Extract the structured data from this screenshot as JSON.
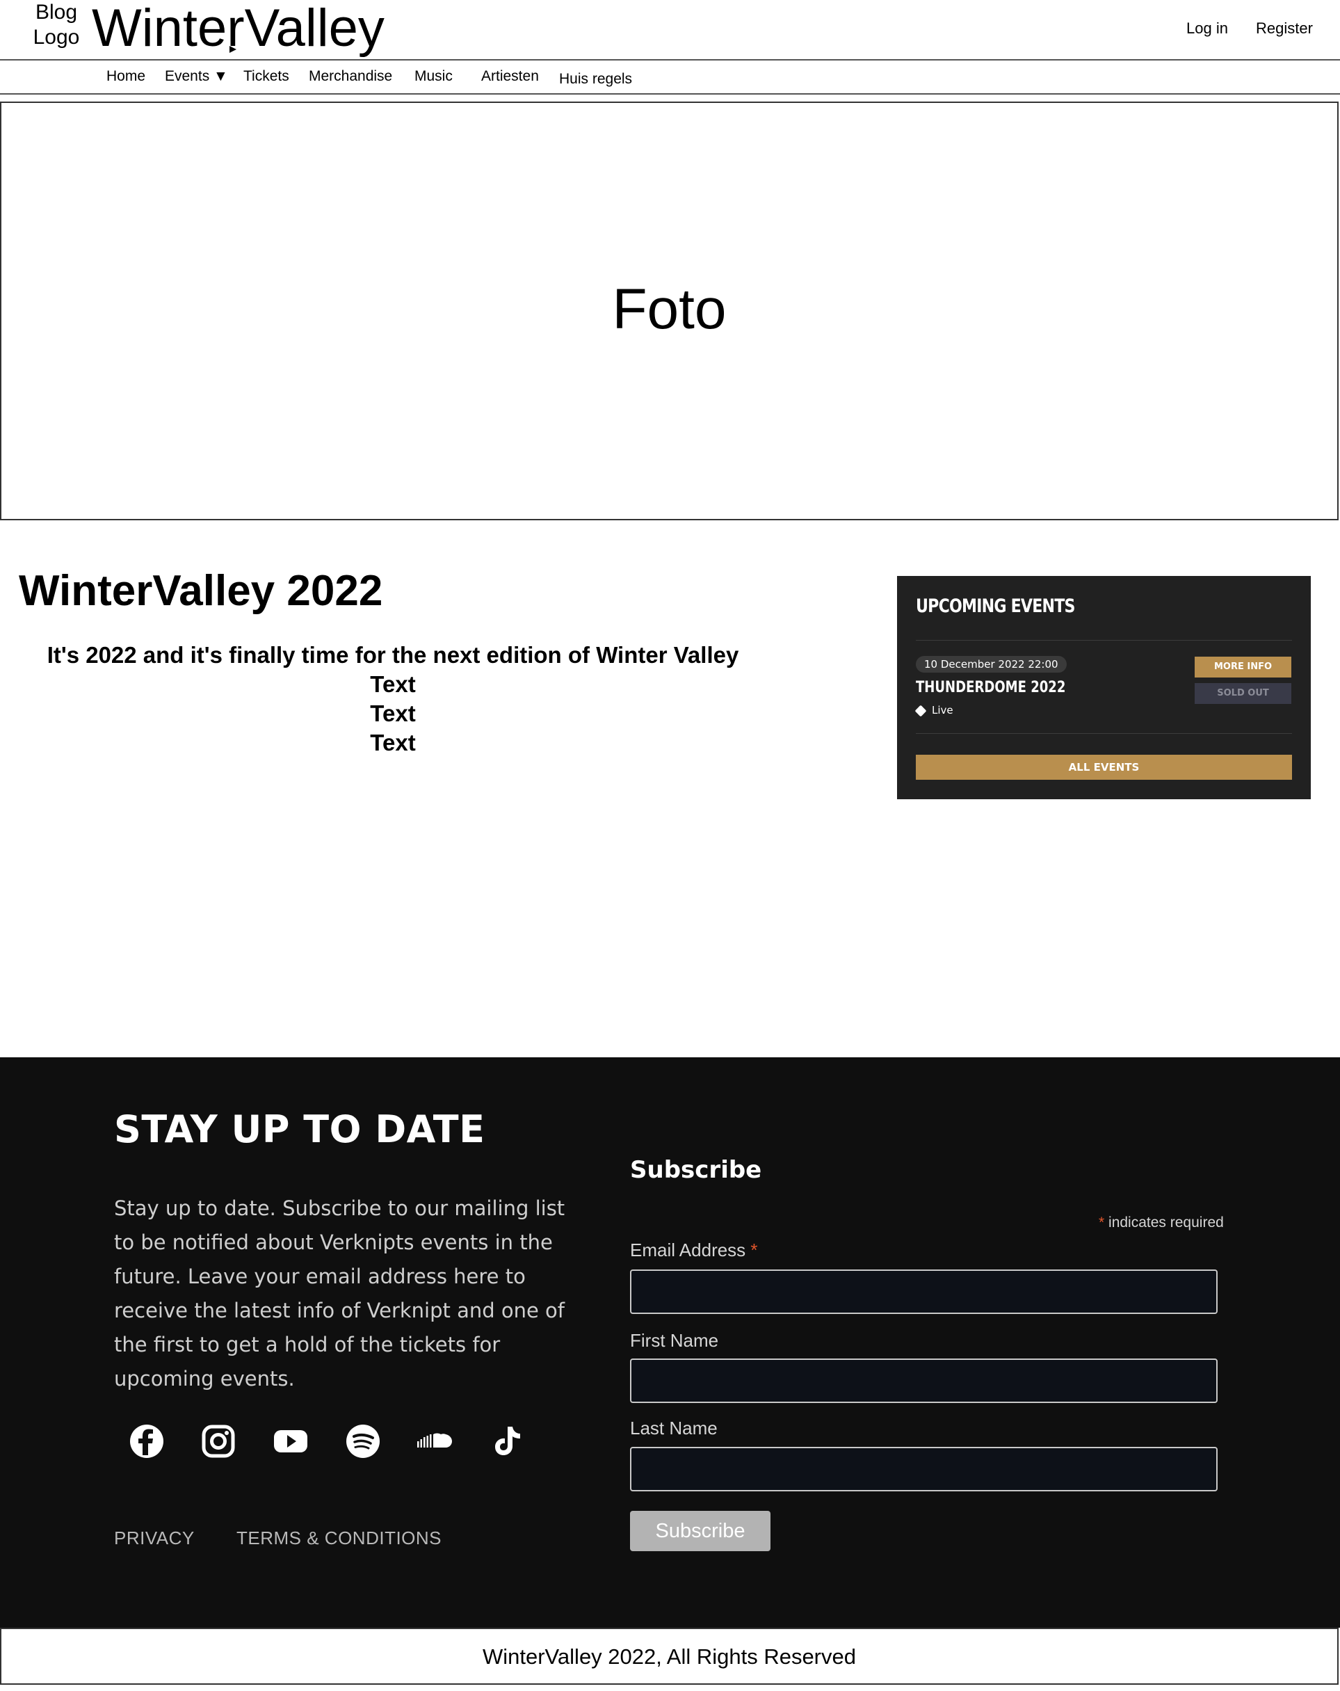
{
  "header": {
    "logo_text": "Blog Logo",
    "site_title": "WinterValley",
    "login": "Log in",
    "register": "Register"
  },
  "nav": {
    "items": [
      "Home",
      "Events ▼",
      "Tickets",
      "Merchandise",
      "Music",
      "Artiesten",
      "Huis regels"
    ]
  },
  "hero": {
    "label": "Foto"
  },
  "intro": {
    "title": "WinterValley 2022",
    "lines": [
      "It's 2022 and it's finally time for the next edition of Winter Valley",
      "Text",
      "Text",
      "Text"
    ]
  },
  "events_widget": {
    "title": "UPCOMING EVENTS",
    "event": {
      "date": "10 December 2022 22:00",
      "name": "THUNDERDOME 2022",
      "status": "Live",
      "more_info": "MORE INFO",
      "sold_out": "SOLD OUT"
    },
    "all_events": "ALL EVENTS"
  },
  "footer": {
    "stay_title": "STAY UP TO DATE",
    "stay_text": "Stay up to date. Subscribe to our mailing list to be notified about Verknipts events in the future. Leave your email address here to receive the latest info of Verknipt and one of the first to get a hold of the tickets for upcoming events.",
    "social_icons": [
      "facebook-icon",
      "instagram-icon",
      "youtube-icon",
      "spotify-icon",
      "soundcloud-icon",
      "tiktok-icon"
    ],
    "privacy": "PRIVACY",
    "terms": "TERMS & CONDITIONS",
    "form": {
      "title": "Subscribe",
      "required_star": "*",
      "required_note": "indicates required",
      "email_label": "Email Address",
      "first_name_label": "First Name",
      "last_name_label": "Last Name",
      "email_value": "",
      "first_name_value": "",
      "last_name_value": "",
      "submit": "Subscribe"
    },
    "copyright": "WinterValley 2022, All Rights Reserved"
  },
  "colors": {
    "accent_gold": "#b98f4e",
    "widget_bg": "#212121",
    "footer_bg": "#0f0f0f",
    "required_star": "#e0552b"
  }
}
